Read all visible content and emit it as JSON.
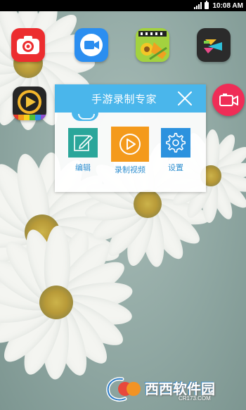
{
  "status_bar": {
    "time": "10:08 AM"
  },
  "home_icons": [
    {
      "name": "screen-recorder-red",
      "color": "#ec2d2f"
    },
    {
      "name": "video-call-blue",
      "color": "#2b8ef0"
    },
    {
      "name": "film-editor-green",
      "color": "#9bd043"
    },
    {
      "name": "video-player-dark",
      "color": "#2b2b2b"
    },
    {
      "name": "video-player-gold",
      "color": "#262626"
    }
  ],
  "floating_button": {
    "icon": "record-camera-icon",
    "color": "#ef2d57"
  },
  "panel": {
    "title": "手游录制专家",
    "header_color": "#4ab6eb",
    "actions": [
      {
        "label": "编辑",
        "icon": "edit-icon",
        "color": "#2aa69a"
      },
      {
        "label": "录制视频",
        "icon": "play-icon",
        "color": "#f49a1b"
      },
      {
        "label": "设置",
        "icon": "gear-icon",
        "color": "#2c92de"
      }
    ]
  },
  "watermark": {
    "text": "西西软件园",
    "sub": "CR173.COM"
  }
}
